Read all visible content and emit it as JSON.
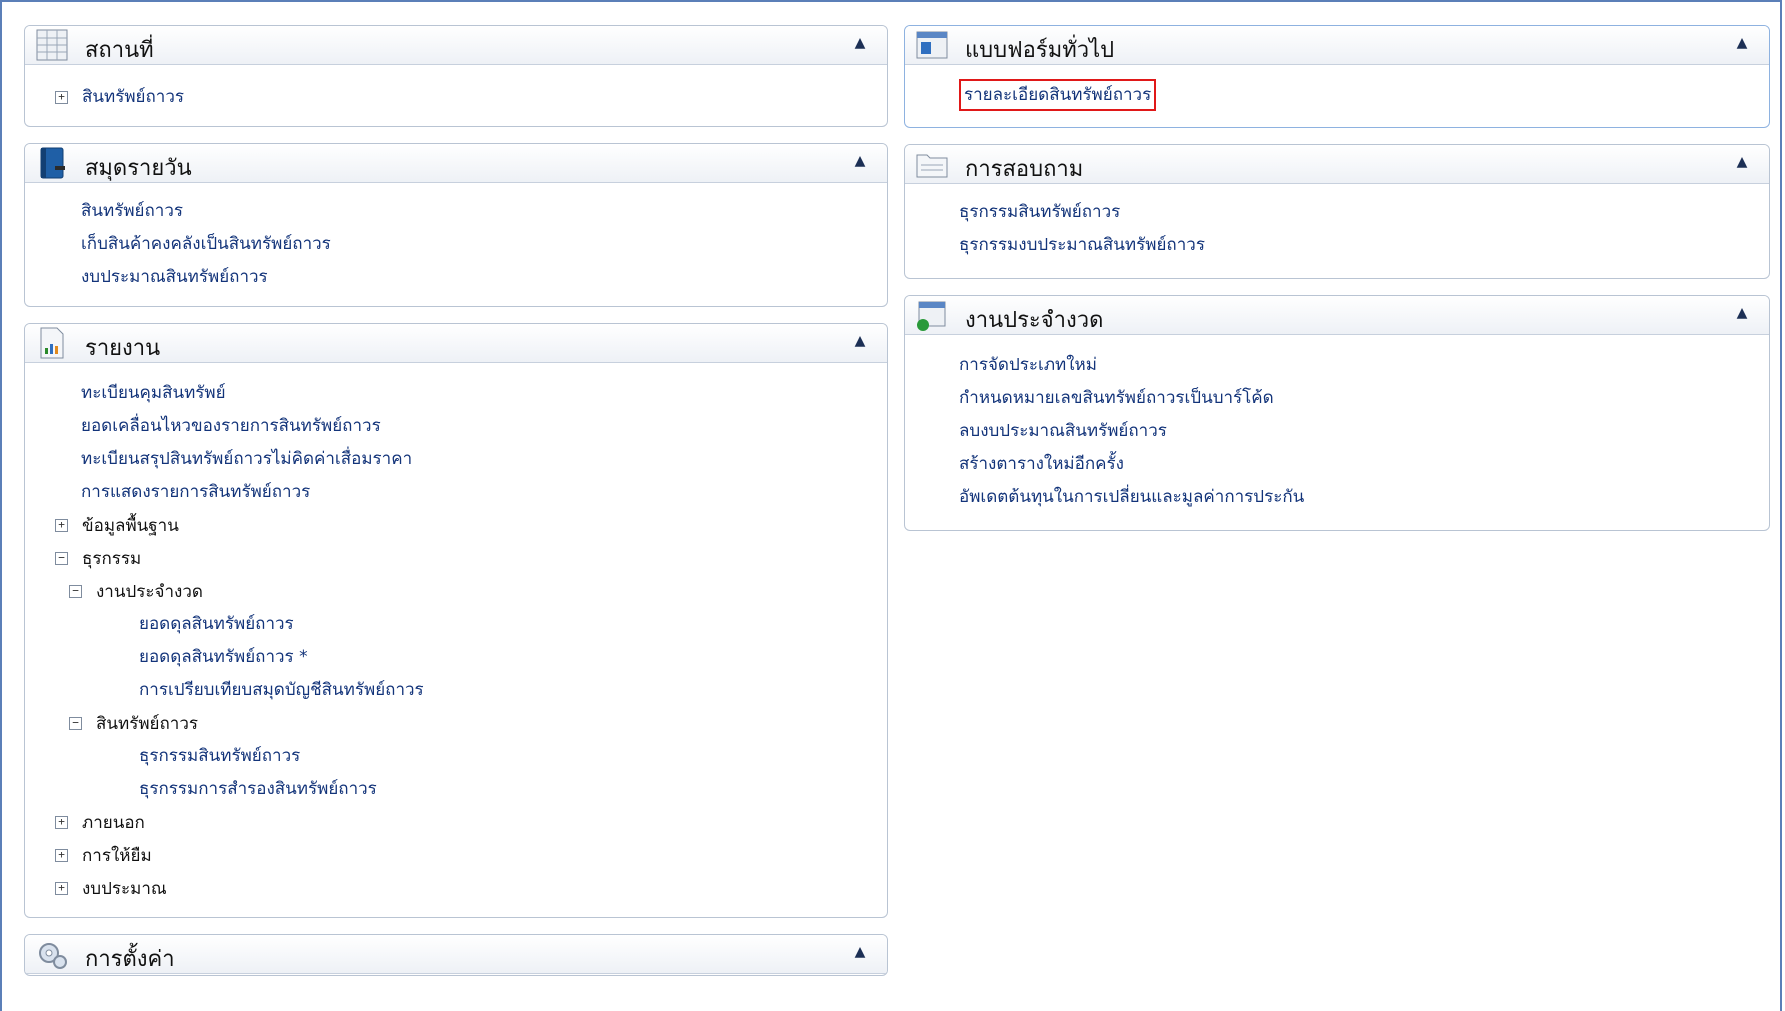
{
  "left": {
    "location": {
      "title": "สถานที่",
      "items": [
        {
          "toggle": "⊞",
          "label": "สินทรัพย์ถาวร"
        }
      ]
    },
    "journals": {
      "title": "สมุดรายวัน",
      "links": [
        "สินทรัพย์ถาวร",
        "เก็บสินค้าคงคลังเป็นสินทรัพย์ถาวร",
        "งบประมาณสินทรัพย์ถาวร"
      ]
    },
    "reports": {
      "title": "รายงาน",
      "links": [
        "ทะเบียนคุมสินทรัพย์",
        "ยอดเคลื่อนไหวของรายการสินทรัพย์ถาวร",
        "ทะเบียนสรุปสินทรัพย์ถาวรไม่คิดค่าเสื่อมราคา",
        "การแสดงรายการสินทรัพย์ถาวร"
      ],
      "tree": {
        "basic": "ข้อมูลพื้นฐาน",
        "transactions": "ธุรกรรม",
        "periodic": "งานประจำงวด",
        "periodic_links": [
          "ยอดดุลสินทรัพย์ถาวร",
          "ยอดดุลสินทรัพย์ถาวร *",
          "การเปรียบเทียบสมุดบัญชีสินทรัพย์ถาวร"
        ],
        "fixed_assets": "สินทรัพย์ถาวร",
        "fixed_assets_links": [
          "ธุรกรรมสินทรัพย์ถาวร",
          "ธุรกรรมการสำรองสินทรัพย์ถาวร"
        ],
        "external": "ภายนอก",
        "lending": "การให้ยืม",
        "budget": "งบประมาณ"
      }
    },
    "settings": {
      "title": "การตั้งค่า"
    }
  },
  "right": {
    "forms": {
      "title": "แบบฟอร์มทั่วไป",
      "links": [
        "รายละเอียดสินทรัพย์ถาวร"
      ]
    },
    "inquiries": {
      "title": "การสอบถาม",
      "links": [
        "ธุรกรรมสินทรัพย์ถาวร",
        "ธุรกรรมงบประมาณสินทรัพย์ถาวร"
      ]
    },
    "periodic": {
      "title": "งานประจำงวด",
      "links": [
        "การจัดประเภทใหม่",
        "กำหนดหมายเลขสินทรัพย์ถาวรเป็นบาร์โค้ด",
        "ลบงบประมาณสินทรัพย์ถาวร",
        "สร้างตารางใหม่อีกครั้ง",
        "อัพเดตต้นทุนในการเปลี่ยนและมูลค่าการประกัน"
      ]
    }
  },
  "colors": {
    "link": "#13347a",
    "highlight_border": "#e01818",
    "frame": "#5b7fb8"
  },
  "icons": {
    "collapse": "chevron-up-icon",
    "expand": "plus-box-icon",
    "collapse_tree": "minus-box-icon"
  }
}
